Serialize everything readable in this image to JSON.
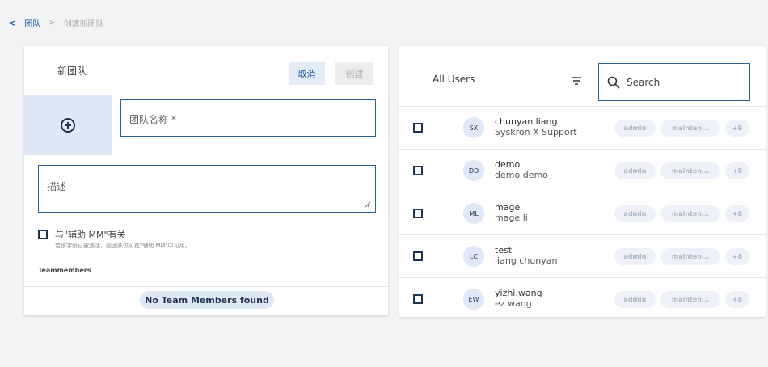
{
  "breadcrumb": {
    "back_icon": "chevron-left-icon",
    "parent": "团队",
    "separator": ">",
    "current": "创建新团队"
  },
  "new_team": {
    "title": "新团队",
    "cancel_label": "取消",
    "create_label": "创建",
    "avatar_icon": "plus-circle-icon",
    "name_placeholder": "团队名称 *",
    "desc_placeholder": "描述",
    "assist_label": "与\"辅助 MM\"有关",
    "assist_hint": "若该字段已被激活，则团队仅可在\"辅助 MM\"中可用。",
    "members_label": "Teammembers",
    "empty_text": "No Team Members found"
  },
  "users": {
    "title": "All Users",
    "search_placeholder": "Search",
    "rows": [
      {
        "initials": "SX",
        "name": "chunyan.liang",
        "full": "Syskron X Support",
        "roles": [
          "admin",
          "mainten...",
          "+9"
        ]
      },
      {
        "initials": "DD",
        "name": "demo",
        "full": "demo demo",
        "roles": [
          "admin",
          "mainten...",
          "+8"
        ]
      },
      {
        "initials": "ML",
        "name": "mage",
        "full": "mage li",
        "roles": [
          "admin",
          "mainten...",
          "+8"
        ]
      },
      {
        "initials": "LC",
        "name": "test",
        "full": "liang chunyan",
        "roles": [
          "admin",
          "mainten...",
          "+8"
        ]
      },
      {
        "initials": "EW",
        "name": "yizhi.wang",
        "full": "ez wang",
        "roles": [
          "admin",
          "mainten...",
          "+8"
        ]
      }
    ]
  },
  "colors": {
    "accent": "#1a56a8",
    "border": "#2a5f96",
    "chip": "#dfe8f6",
    "dark": "#1f3450"
  }
}
